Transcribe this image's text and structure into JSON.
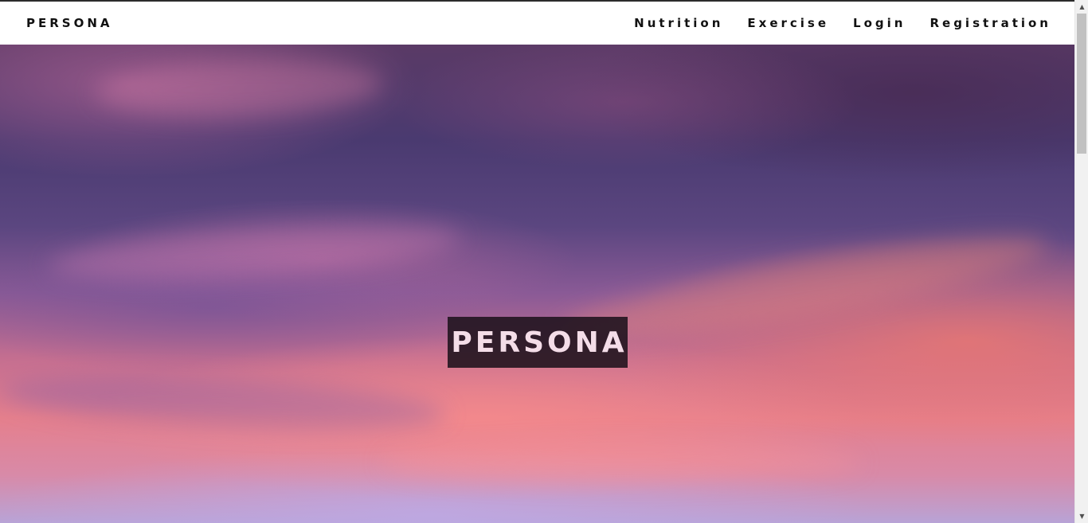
{
  "navbar": {
    "brand": "PERSONA",
    "links": [
      {
        "label": "Nutrition"
      },
      {
        "label": "Exercise"
      },
      {
        "label": "Login"
      },
      {
        "label": "Registration"
      }
    ]
  },
  "hero": {
    "title": "PERSONA"
  },
  "scrollbar": {
    "up_icon": "▲",
    "down_icon": "▼"
  },
  "colors": {
    "navbar_bg": "#ffffff",
    "nav_text": "#111111",
    "hero_title_bg": "#1e121c",
    "hero_title_text": "#f4dde8"
  }
}
